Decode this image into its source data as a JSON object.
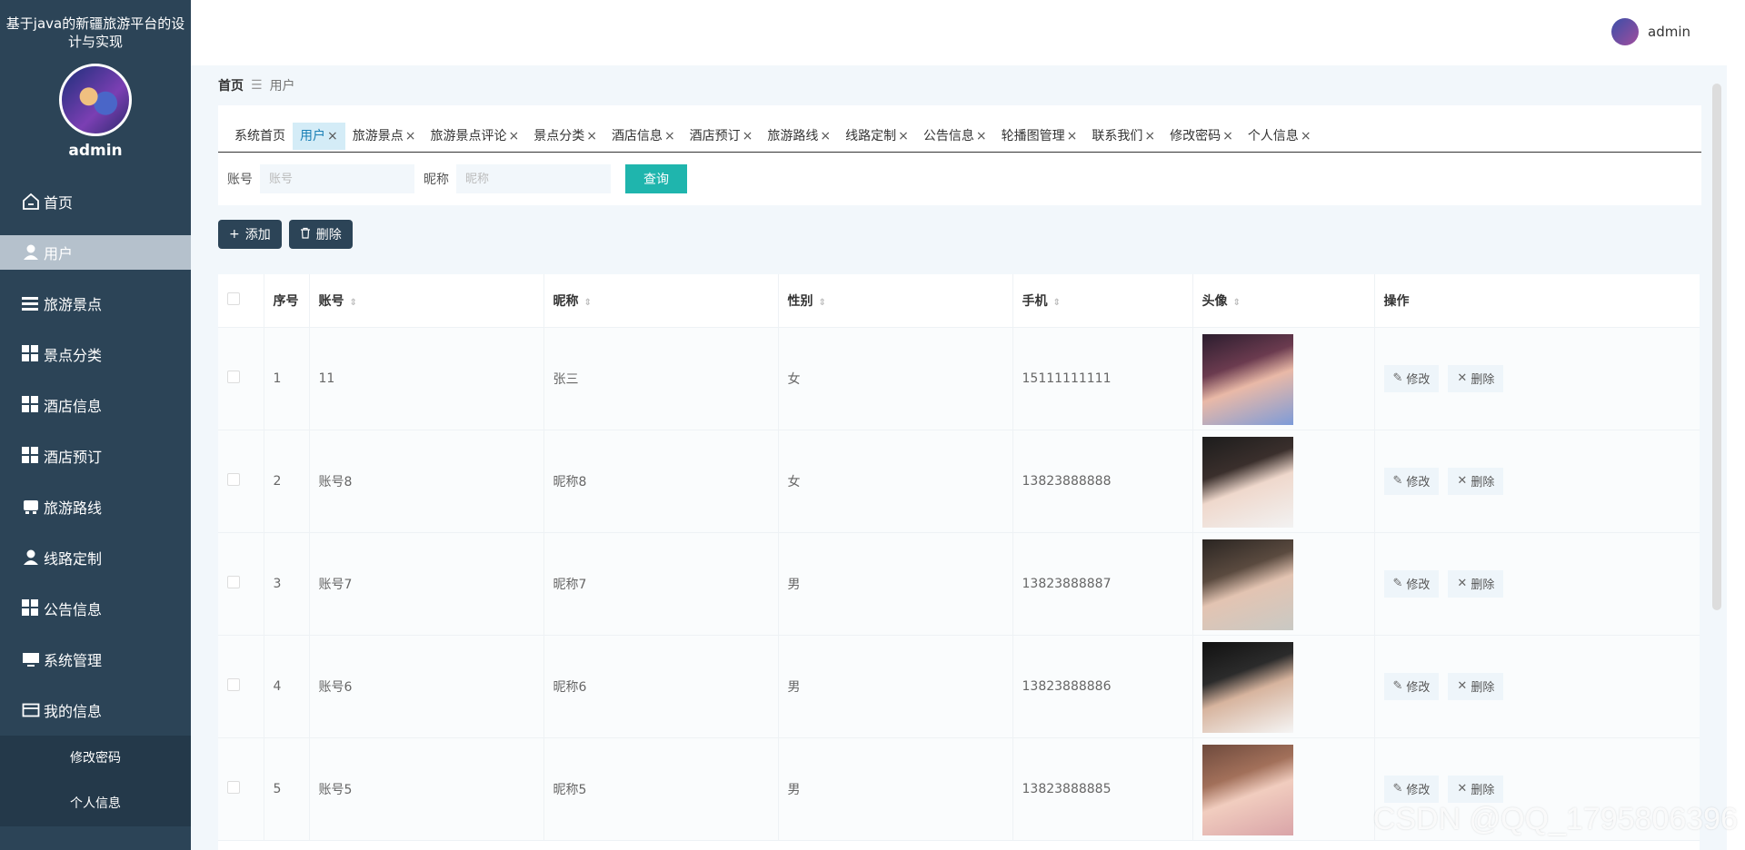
{
  "sidebar": {
    "title": "基于java的新疆旅游平台的设计与实现",
    "username": "admin",
    "menu": [
      {
        "label": "首页",
        "icon": "home-icon"
      },
      {
        "label": "用户",
        "icon": "user-icon"
      },
      {
        "label": "旅游景点",
        "icon": "list-icon"
      },
      {
        "label": "景点分类",
        "icon": "grid-icon"
      },
      {
        "label": "酒店信息",
        "icon": "grid-icon"
      },
      {
        "label": "酒店预订",
        "icon": "grid-icon"
      },
      {
        "label": "旅游路线",
        "icon": "bus-icon"
      },
      {
        "label": "线路定制",
        "icon": "user-icon"
      },
      {
        "label": "公告信息",
        "icon": "grid-icon"
      },
      {
        "label": "系统管理",
        "icon": "monitor-icon"
      },
      {
        "label": "我的信息",
        "icon": "card-icon"
      }
    ],
    "submenu": [
      "修改密码",
      "个人信息"
    ]
  },
  "header": {
    "username": "admin"
  },
  "breadcrumb": {
    "home": "首页",
    "current": "用户"
  },
  "tabs": [
    "系统首页",
    "用户",
    "旅游景点",
    "旅游景点评论",
    "景点分类",
    "酒店信息",
    "酒店预订",
    "旅游路线",
    "线路定制",
    "公告信息",
    "轮播图管理",
    "联系我们",
    "修改密码",
    "个人信息"
  ],
  "search": {
    "account_label": "账号",
    "account_placeholder": "账号",
    "nickname_label": "昵称",
    "nickname_placeholder": "昵称",
    "query_label": "查询"
  },
  "actions": {
    "add_label": "添加",
    "delete_label": "删除"
  },
  "table": {
    "headers": {
      "index": "序号",
      "account": "账号",
      "nickname": "昵称",
      "gender": "性别",
      "phone": "手机",
      "avatar": "头像",
      "ops": "操作"
    },
    "rows": [
      {
        "index": "1",
        "account": "11",
        "nickname": "张三",
        "gender": "女",
        "phone": "15111111111"
      },
      {
        "index": "2",
        "account": "账号8",
        "nickname": "昵称8",
        "gender": "女",
        "phone": "13823888888"
      },
      {
        "index": "3",
        "account": "账号7",
        "nickname": "昵称7",
        "gender": "男",
        "phone": "13823888887"
      },
      {
        "index": "4",
        "account": "账号6",
        "nickname": "昵称6",
        "gender": "男",
        "phone": "13823888886"
      },
      {
        "index": "5",
        "account": "账号5",
        "nickname": "昵称5",
        "gender": "男",
        "phone": "13823888885"
      }
    ],
    "edit_label": "修改",
    "delete_label": "删除"
  },
  "watermark": "CSDN @QQ_1795806396",
  "colors": {
    "sidebar": "#2c4457",
    "accent": "#1fb5ad",
    "active_tab": "#d4ecf7"
  }
}
